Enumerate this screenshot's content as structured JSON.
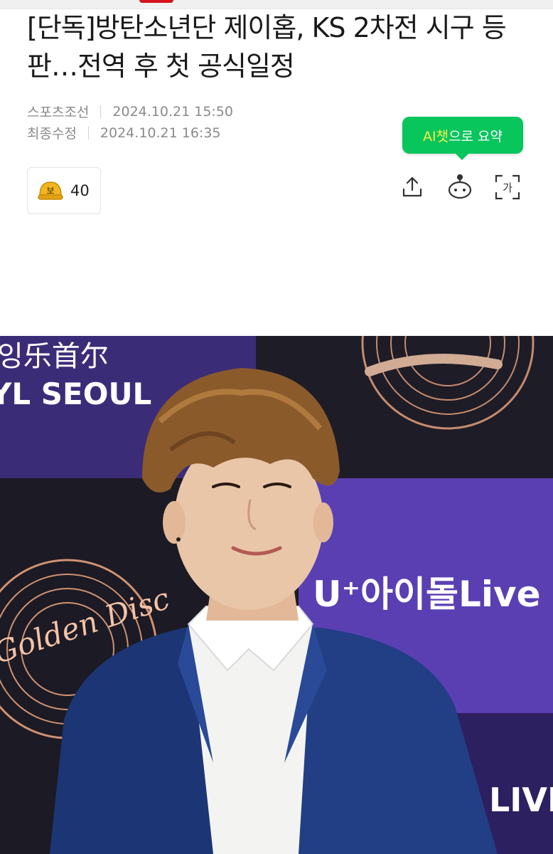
{
  "article": {
    "headline": "[단독]방탄소년단 제이홉, KS 2차전 시구 등판…전역 후 첫 공식일정",
    "source": "스포츠조선",
    "published": "2024.10.21 15:50",
    "updated_label": "최종수정",
    "updated": "2024.10.21 16:35"
  },
  "ai_summary": {
    "label_highlight": "AI챗",
    "label_rest": "으로 요약"
  },
  "reaction": {
    "icon": "helmet-icon",
    "glyph": "보",
    "count": "40"
  },
  "toolbar": {
    "icons": [
      "share-icon",
      "chatbot-icon",
      "font-size-icon"
    ],
    "font_glyph": "가"
  },
  "photo": {
    "backdrop_text_top_left": "잉乐首尔",
    "backdrop_text_seoul": "YL SEOUL",
    "backdrop_text_uplus": "U⁺아이돌Live",
    "backdrop_text_live": "LIVE",
    "backdrop_text_golden": "Golden Disc",
    "colors": {
      "purple_panel": "#5b3fb2",
      "dark_panel": "#1f1d2a",
      "jacket": "#233f86",
      "shirt": "#f4f4f2",
      "hair": "#8a5a2c",
      "skin": "#e9c3a5"
    }
  }
}
